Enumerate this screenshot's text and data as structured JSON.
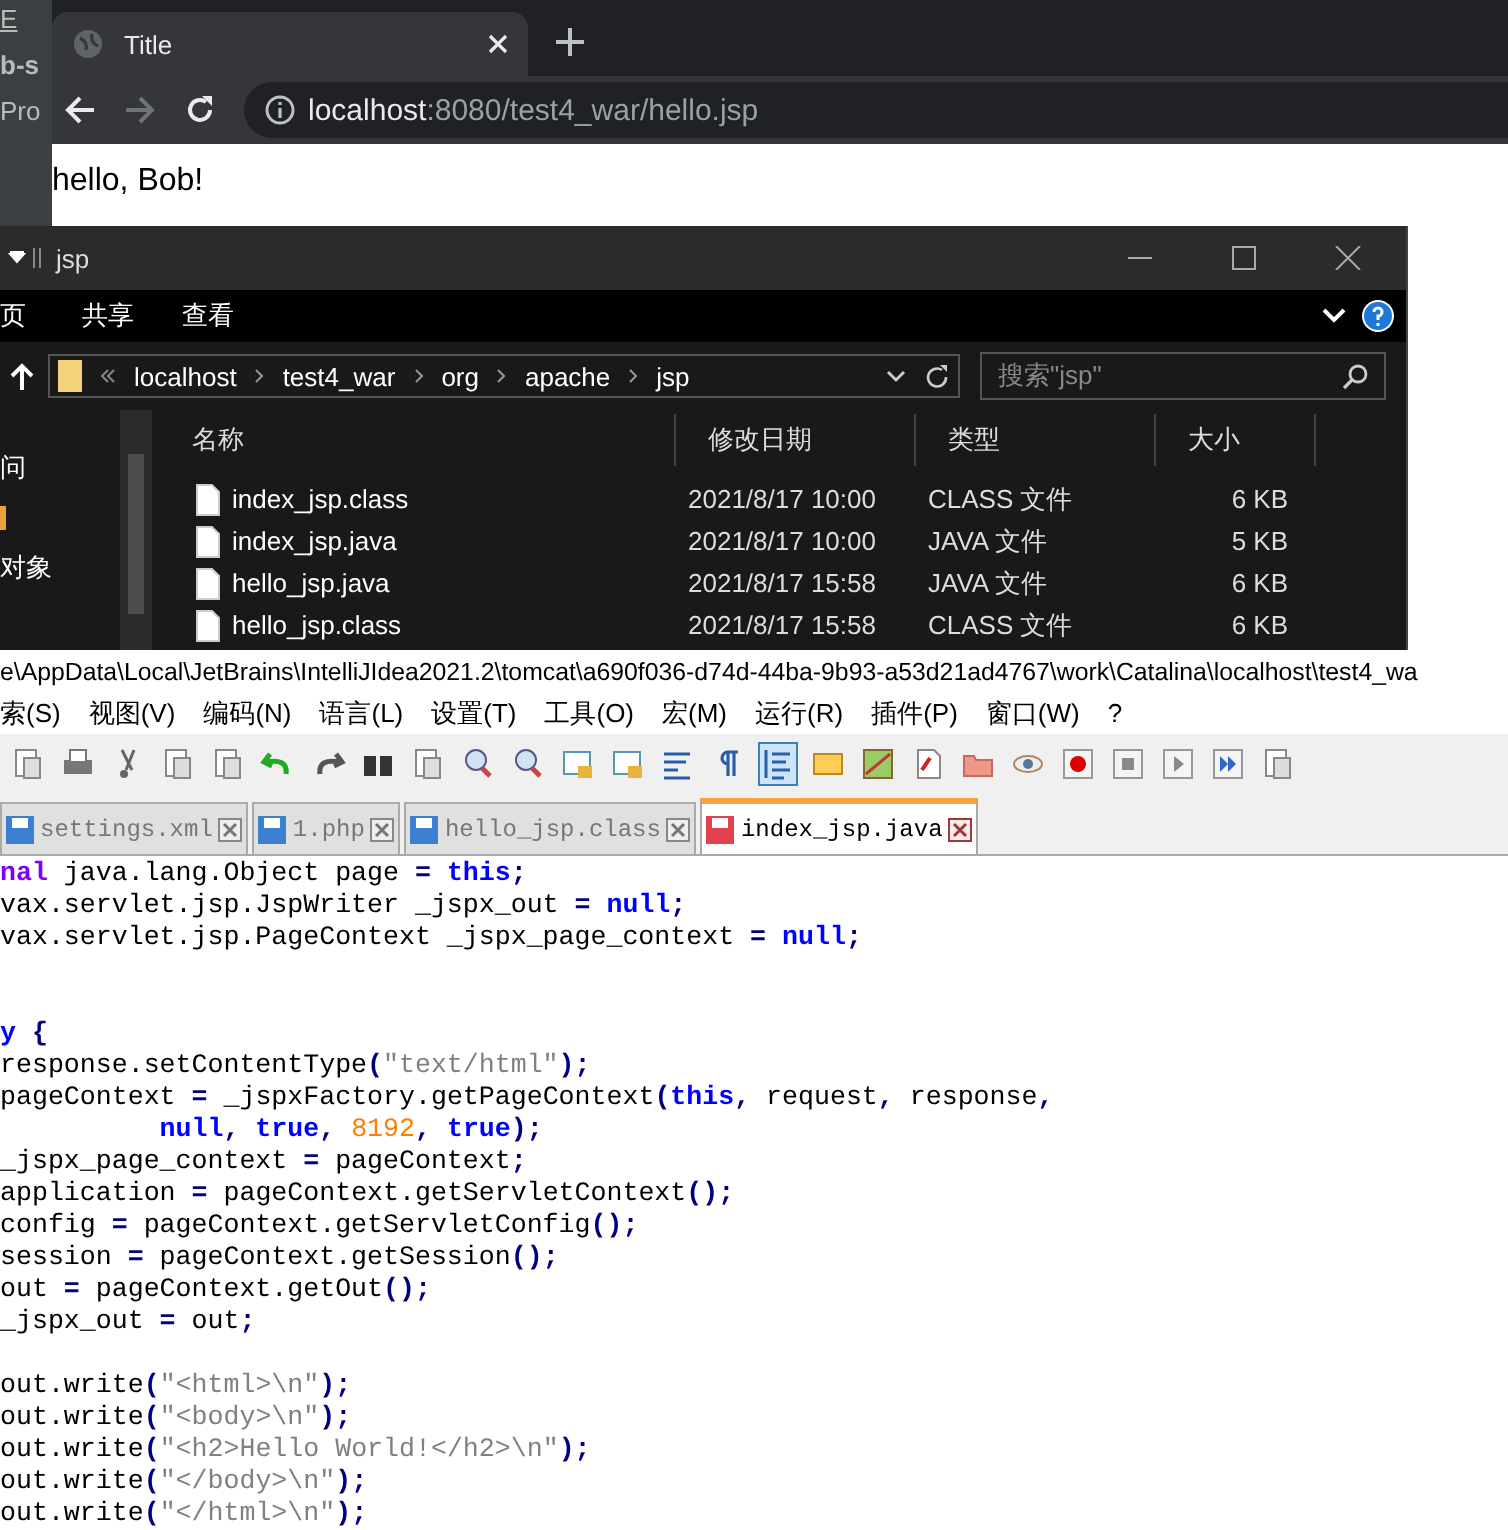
{
  "background_window": {
    "fragments": [
      "E",
      "b-s",
      "Pro"
    ]
  },
  "browser": {
    "tabs": [
      {
        "title": "Title",
        "selected": true
      }
    ],
    "address": {
      "host": "localhost",
      "path": ":8080/test4_war/hello.jsp"
    },
    "page_text": "hello, Bob!"
  },
  "explorer": {
    "title": "jsp",
    "ribbon_tabs": [
      "页",
      "共享",
      "查看"
    ],
    "breadcrumb": [
      "localhost",
      "test4_war",
      "org",
      "apache",
      "jsp"
    ],
    "search": {
      "placeholder": "搜索\"jsp\""
    },
    "nav_items": [
      "问",
      "对象"
    ],
    "columns": [
      "名称",
      "修改日期",
      "类型",
      "大小"
    ],
    "files": [
      {
        "name": "index_jsp.class",
        "modified": "2021/8/17 10:00",
        "type": "CLASS 文件",
        "size": "6 KB"
      },
      {
        "name": "index_jsp.java",
        "modified": "2021/8/17 10:00",
        "type": "JAVA 文件",
        "size": "5 KB"
      },
      {
        "name": "hello_jsp.java",
        "modified": "2021/8/17 15:58",
        "type": "JAVA 文件",
        "size": "6 KB"
      },
      {
        "name": "hello_jsp.class",
        "modified": "2021/8/17 15:58",
        "type": "CLASS 文件",
        "size": "6 KB"
      }
    ]
  },
  "editor": {
    "path": "e\\AppData\\Local\\JetBrains\\IntelliJIdea2021.2\\tomcat\\a690f036-d74d-44ba-9b93-a53d21ad4767\\work\\Catalina\\localhost\\test4_wa",
    "menu": [
      "索(S)",
      "视图(V)",
      "编码(N)",
      "语言(L)",
      "设置(T)",
      "工具(O)",
      "宏(M)",
      "运行(R)",
      "插件(P)",
      "窗口(W)",
      "?"
    ],
    "toolbar": [
      {
        "pressed": false
      },
      {
        "pressed": false
      },
      {
        "pressed": false
      },
      {
        "pressed": false
      },
      {
        "pressed": false
      },
      {
        "pressed": false
      },
      {
        "pressed": false
      },
      {
        "pressed": false
      },
      {
        "pressed": false
      },
      {
        "pressed": false
      },
      {
        "pressed": false
      },
      {
        "pressed": false
      },
      {
        "pressed": false
      },
      {
        "pressed": false
      },
      {
        "pressed": false
      },
      {
        "pressed": true
      },
      {
        "pressed": false
      },
      {
        "pressed": false
      },
      {
        "pressed": false
      },
      {
        "pressed": false
      },
      {
        "pressed": false
      },
      {
        "pressed": false
      },
      {
        "pressed": false
      },
      {
        "pressed": false
      },
      {
        "pressed": false
      },
      {
        "pressed": false
      }
    ],
    "tabs": [
      {
        "label": "settings.xml",
        "selected": false,
        "modified": false
      },
      {
        "label": "1.php",
        "selected": false,
        "modified": false
      },
      {
        "label": "hello_jsp.class",
        "selected": false,
        "modified": false
      },
      {
        "label": "index_jsp.java",
        "selected": true,
        "modified": true
      }
    ],
    "code": [
      {
        "kind": "code",
        "tokens": [
          {
            "kind": "modifier",
            "text": "nal"
          },
          {
            "kind": "plain",
            "text": " java.lang.Object page "
          },
          {
            "kind": "operator",
            "text": "="
          },
          {
            "kind": "keyword",
            "text": " this"
          },
          {
            "kind": "operator",
            "text": ";"
          }
        ]
      },
      {
        "kind": "code",
        "tokens": [
          {
            "kind": "plain",
            "text": "vax.servlet.jsp.JspWriter _jspx_out "
          },
          {
            "kind": "operator",
            "text": "="
          },
          {
            "kind": "keyword",
            "text": " null"
          },
          {
            "kind": "operator",
            "text": ";"
          }
        ]
      },
      {
        "kind": "code",
        "tokens": [
          {
            "kind": "plain",
            "text": "vax.servlet.jsp.PageContext _jspx_page_context "
          },
          {
            "kind": "operator",
            "text": "="
          },
          {
            "kind": "keyword",
            "text": " null"
          },
          {
            "kind": "operator",
            "text": ";"
          }
        ]
      },
      {
        "kind": "blank"
      },
      {
        "kind": "blank"
      },
      {
        "kind": "code",
        "tokens": [
          {
            "kind": "keyword",
            "text": "y"
          },
          {
            "kind": "operator",
            "text": " {"
          }
        ]
      },
      {
        "kind": "code",
        "tokens": [
          {
            "kind": "plain",
            "text": "response.setContentType"
          },
          {
            "kind": "operator",
            "text": "("
          },
          {
            "kind": "string",
            "text": "\"text/html\""
          },
          {
            "kind": "operator",
            "text": ");"
          }
        ]
      },
      {
        "kind": "code",
        "tokens": [
          {
            "kind": "plain",
            "text": "pageContext "
          },
          {
            "kind": "operator",
            "text": "="
          },
          {
            "kind": "plain",
            "text": " _jspxFactory.getPageContext"
          },
          {
            "kind": "operator",
            "text": "("
          },
          {
            "kind": "keyword",
            "text": "this"
          },
          {
            "kind": "operator",
            "text": ","
          },
          {
            "kind": "plain",
            "text": " request"
          },
          {
            "kind": "operator",
            "text": ","
          },
          {
            "kind": "plain",
            "text": " response"
          },
          {
            "kind": "operator",
            "text": ","
          }
        ]
      },
      {
        "kind": "code",
        "tokens": [
          {
            "kind": "keyword",
            "text": "          null"
          },
          {
            "kind": "operator",
            "text": ","
          },
          {
            "kind": "keyword",
            "text": " true"
          },
          {
            "kind": "operator",
            "text": ","
          },
          {
            "kind": "number",
            "text": " 8192"
          },
          {
            "kind": "operator",
            "text": ","
          },
          {
            "kind": "keyword",
            "text": " true"
          },
          {
            "kind": "operator",
            "text": ");"
          }
        ]
      },
      {
        "kind": "code",
        "tokens": [
          {
            "kind": "plain",
            "text": "_jspx_page_context "
          },
          {
            "kind": "operator",
            "text": "="
          },
          {
            "kind": "plain",
            "text": " pageContext"
          },
          {
            "kind": "operator",
            "text": ";"
          }
        ]
      },
      {
        "kind": "code",
        "tokens": [
          {
            "kind": "plain",
            "text": "application "
          },
          {
            "kind": "operator",
            "text": "="
          },
          {
            "kind": "plain",
            "text": " pageContext.getServletContext"
          },
          {
            "kind": "operator",
            "text": "();"
          }
        ]
      },
      {
        "kind": "code",
        "tokens": [
          {
            "kind": "plain",
            "text": "config "
          },
          {
            "kind": "operator",
            "text": "="
          },
          {
            "kind": "plain",
            "text": " pageContext.getServletConfig"
          },
          {
            "kind": "operator",
            "text": "();"
          }
        ]
      },
      {
        "kind": "code",
        "tokens": [
          {
            "kind": "plain",
            "text": "session "
          },
          {
            "kind": "operator",
            "text": "="
          },
          {
            "kind": "plain",
            "text": " pageContext.getSession"
          },
          {
            "kind": "operator",
            "text": "();"
          }
        ]
      },
      {
        "kind": "code",
        "tokens": [
          {
            "kind": "plain",
            "text": "out "
          },
          {
            "kind": "operator",
            "text": "="
          },
          {
            "kind": "plain",
            "text": " pageContext.getOut"
          },
          {
            "kind": "operator",
            "text": "();"
          }
        ]
      },
      {
        "kind": "code",
        "tokens": [
          {
            "kind": "plain",
            "text": "_jspx_out "
          },
          {
            "kind": "operator",
            "text": "="
          },
          {
            "kind": "plain",
            "text": " out"
          },
          {
            "kind": "operator",
            "text": ";"
          }
        ]
      },
      {
        "kind": "blank"
      },
      {
        "kind": "code",
        "tokens": [
          {
            "kind": "plain",
            "text": "out.write"
          },
          {
            "kind": "operator",
            "text": "("
          },
          {
            "kind": "string",
            "text": "\"<html>\\n\""
          },
          {
            "kind": "operator",
            "text": ");"
          }
        ]
      },
      {
        "kind": "code",
        "tokens": [
          {
            "kind": "plain",
            "text": "out.write"
          },
          {
            "kind": "operator",
            "text": "("
          },
          {
            "kind": "string",
            "text": "\"<body>\\n\""
          },
          {
            "kind": "operator",
            "text": ");"
          }
        ]
      },
      {
        "kind": "code",
        "tokens": [
          {
            "kind": "plain",
            "text": "out.write"
          },
          {
            "kind": "operator",
            "text": "("
          },
          {
            "kind": "string",
            "text": "\"<h2>Hello World!</h2>\\n\""
          },
          {
            "kind": "operator",
            "text": ");"
          }
        ]
      },
      {
        "kind": "code",
        "tokens": [
          {
            "kind": "plain",
            "text": "out.write"
          },
          {
            "kind": "operator",
            "text": "("
          },
          {
            "kind": "string",
            "text": "\"</body>\\n\""
          },
          {
            "kind": "operator",
            "text": ");"
          }
        ]
      },
      {
        "kind": "code",
        "tokens": [
          {
            "kind": "plain",
            "text": "out.write"
          },
          {
            "kind": "operator",
            "text": "("
          },
          {
            "kind": "string",
            "text": "\"</html>\\n\""
          },
          {
            "kind": "operator",
            "text": ");"
          }
        ]
      }
    ]
  }
}
